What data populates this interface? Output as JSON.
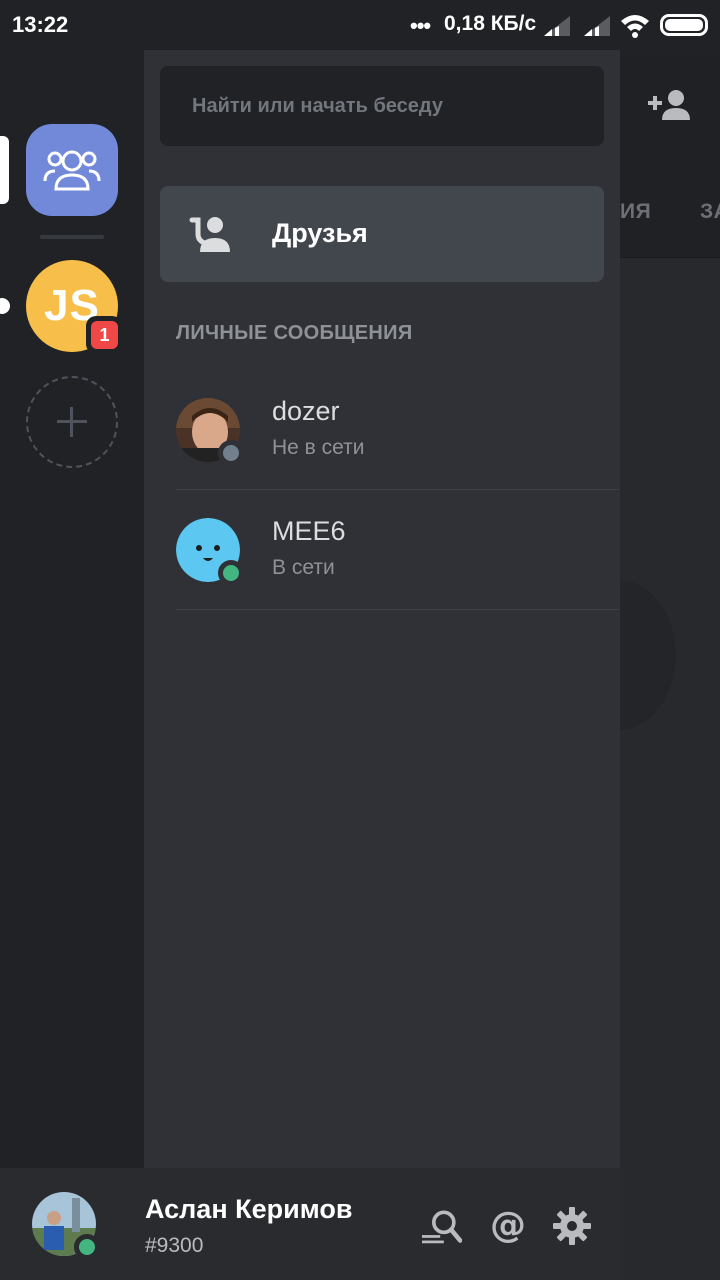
{
  "status_bar": {
    "time": "13:22",
    "dots": "•••",
    "network_speed": "0,18 КБ/с"
  },
  "background": {
    "tab_1_partial": "ИЯ",
    "tab_2_partial": "ЗА"
  },
  "rail": {
    "servers": [
      {
        "name": "home",
        "icon": "people-icon",
        "selected": true
      },
      {
        "name": "JS",
        "initials": "JS",
        "color": "#f7bf4a",
        "unread_badge": "1"
      }
    ]
  },
  "panel": {
    "search_placeholder": "Найти или начать беседу",
    "friends_label": "Друзья",
    "section_title": "ЛИЧНЫЕ СООБЩЕНИЯ",
    "dms": [
      {
        "name": "dozer",
        "status_text": "Не в сети",
        "status_color": "#747f8d"
      },
      {
        "name": "MEE6",
        "status_text": "В сети",
        "status_color": "#43b581"
      }
    ]
  },
  "user": {
    "name": "Аслан Керимов",
    "tag": "#9300",
    "status_color": "#43b581"
  },
  "colors": {
    "accent": "#7289da",
    "online": "#43b581",
    "offline": "#747f8d",
    "badge": "#f04747"
  }
}
